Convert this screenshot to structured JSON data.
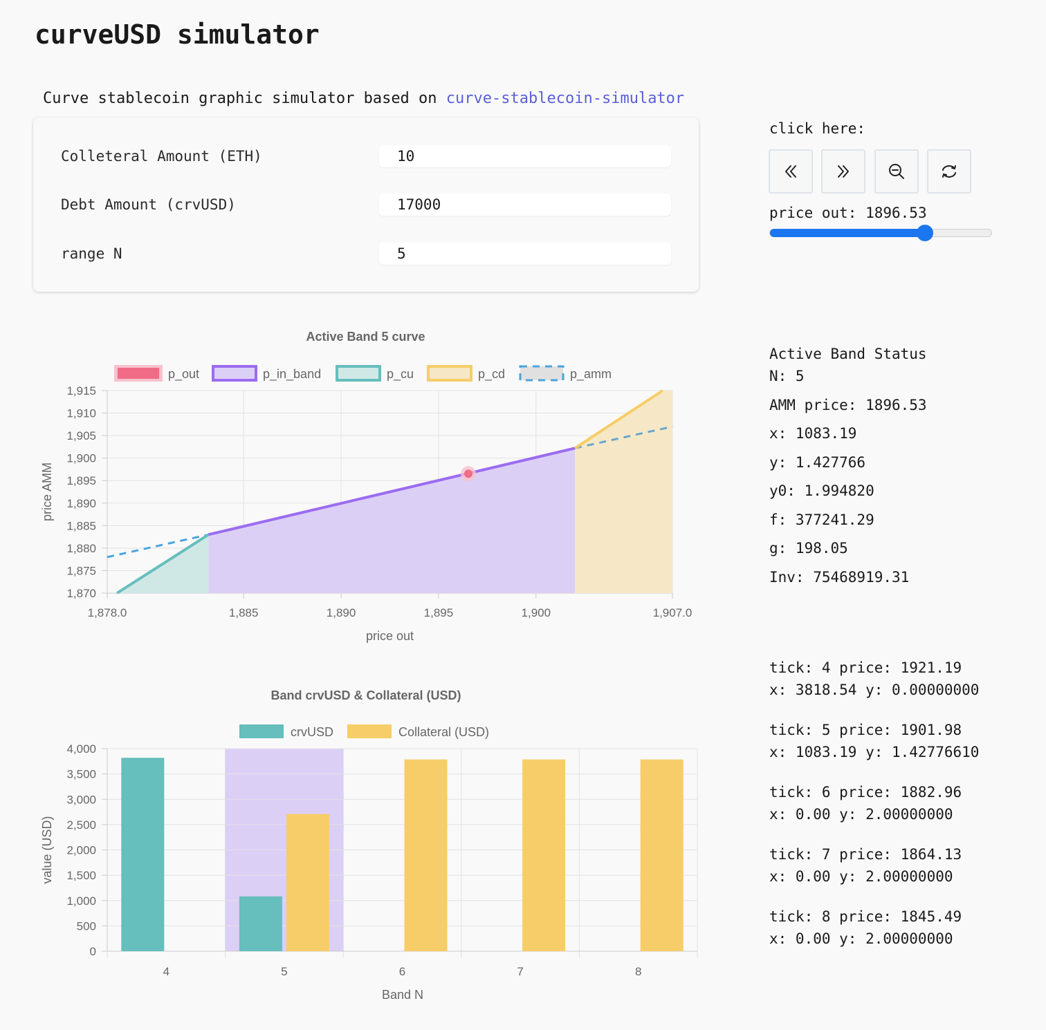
{
  "page": {
    "title": "curveUSD simulator",
    "subtitle_prefix": "Curve stablecoin graphic simulator based on",
    "subtitle_link": "curve-stablecoin-simulator"
  },
  "form": {
    "collateral": {
      "label": "Colleteral Amount (ETH)",
      "value": "10"
    },
    "debt": {
      "label": "Debt Amount (crvUSD)",
      "value": "17000"
    },
    "range": {
      "label": "range N",
      "value": "5"
    }
  },
  "controls": {
    "click_label": "click here:",
    "buttons": [
      {
        "name": "prev-band-button",
        "icon": "double-chevron-left-icon"
      },
      {
        "name": "next-band-button",
        "icon": "double-chevron-right-icon"
      },
      {
        "name": "zoom-out-button",
        "icon": "zoom-out-icon"
      },
      {
        "name": "reset-button",
        "icon": "refresh-icon"
      }
    ],
    "price_out_label": "price out:",
    "price_out_value": "1896.53",
    "slider_fraction": 0.7,
    "slider_color": "#1c76f0"
  },
  "status": {
    "title": "Active Band Status",
    "n": "N: 5",
    "amm_price": "AMM price: 1896.53",
    "x": "x: 1083.19",
    "y": "y: 1.427766",
    "y0": "y0: 1.994820",
    "f": "f: 377241.29",
    "g": "g: 198.05",
    "inv": "Inv: 75468919.31"
  },
  "ticks": [
    {
      "line1": "tick: 4 price: 1921.19",
      "line2": "x: 3818.54 y: 0.00000000"
    },
    {
      "line1": "tick: 5 price: 1901.98",
      "line2": "x: 1083.19 y: 1.42776610"
    },
    {
      "line1": "tick: 6 price: 1882.96",
      "line2": "x: 0.00 y: 2.00000000"
    },
    {
      "line1": "tick: 7 price: 1864.13",
      "line2": "x: 0.00 y: 2.00000000"
    },
    {
      "line1": "tick: 8 price: 1845.49",
      "line2": "x: 0.00 y: 2.00000000"
    }
  ],
  "chart_data": [
    {
      "type": "line",
      "title": "Active Band 5 curve",
      "xlabel": "price out",
      "ylabel": "price AMM",
      "xlim": [
        1878.0,
        1907.0
      ],
      "ylim": [
        1870,
        1915
      ],
      "x_ticks": [
        "1,878.0",
        "1,885",
        "1,890",
        "1,895",
        "1,900",
        "1,907.0"
      ],
      "x_tick_values": [
        1878.0,
        1885,
        1890,
        1895,
        1900,
        1907.0
      ],
      "y_ticks": [
        "1,915",
        "1,910",
        "1,905",
        "1,900",
        "1,895",
        "1,890",
        "1,885",
        "1,880",
        "1,875",
        "1,870"
      ],
      "y_tick_values": [
        1915,
        1910,
        1905,
        1900,
        1895,
        1890,
        1885,
        1880,
        1875,
        1870
      ],
      "grid": true,
      "legend_position": "top",
      "series": [
        {
          "name": "p_out",
          "color": "#f06b85",
          "points": [
            [
              1896.53,
              1896.53
            ]
          ]
        },
        {
          "name": "p_in_band",
          "color": "#9b6cf0",
          "fill": "#dccff6",
          "points": [
            [
              1883.2,
              1883.0
            ],
            [
              1902.0,
              1902.2
            ]
          ]
        },
        {
          "name": "p_cu",
          "color": "#66bebd",
          "fill": "#cfe8e5",
          "points": [
            [
              1878.5,
              1870.0
            ],
            [
              1883.2,
              1883.0
            ]
          ]
        },
        {
          "name": "p_cd",
          "color": "#f6cd68",
          "fill": "#f6e8c6",
          "points": [
            [
              1902.0,
              1902.2
            ],
            [
              1906.5,
              1915.0
            ]
          ]
        },
        {
          "name": "p_amm",
          "color": "#4aa3df",
          "dashed": true,
          "points": [
            [
              1878.0,
              1878.0
            ],
            [
              1883.2,
              1883.0
            ],
            [
              1902.0,
              1902.2
            ],
            [
              1907.0,
              1907.0
            ]
          ]
        }
      ]
    },
    {
      "type": "bar",
      "title": "Band crvUSD & Collateral (USD)",
      "xlabel": "Band N",
      "ylabel": "value (USD)",
      "ylim": [
        0,
        4000
      ],
      "categories": [
        "4",
        "5",
        "6",
        "7",
        "8"
      ],
      "y_ticks": [
        "4,000",
        "3,500",
        "3,000",
        "2,500",
        "2,000",
        "1,500",
        "1,000",
        "500",
        "0"
      ],
      "y_tick_values": [
        4000,
        3500,
        3000,
        2500,
        2000,
        1500,
        1000,
        500,
        0
      ],
      "highlight_category": "5",
      "highlight_color": "#dccff6",
      "grid": true,
      "legend_position": "top",
      "series": [
        {
          "name": "crvUSD",
          "color": "#66bebd",
          "values": [
            3818.54,
            1083.19,
            0,
            0,
            0
          ]
        },
        {
          "name": "Collateral (USD)",
          "color": "#f6cd68",
          "values": [
            0,
            2708,
            3787,
            3787,
            3787
          ]
        }
      ]
    }
  ]
}
